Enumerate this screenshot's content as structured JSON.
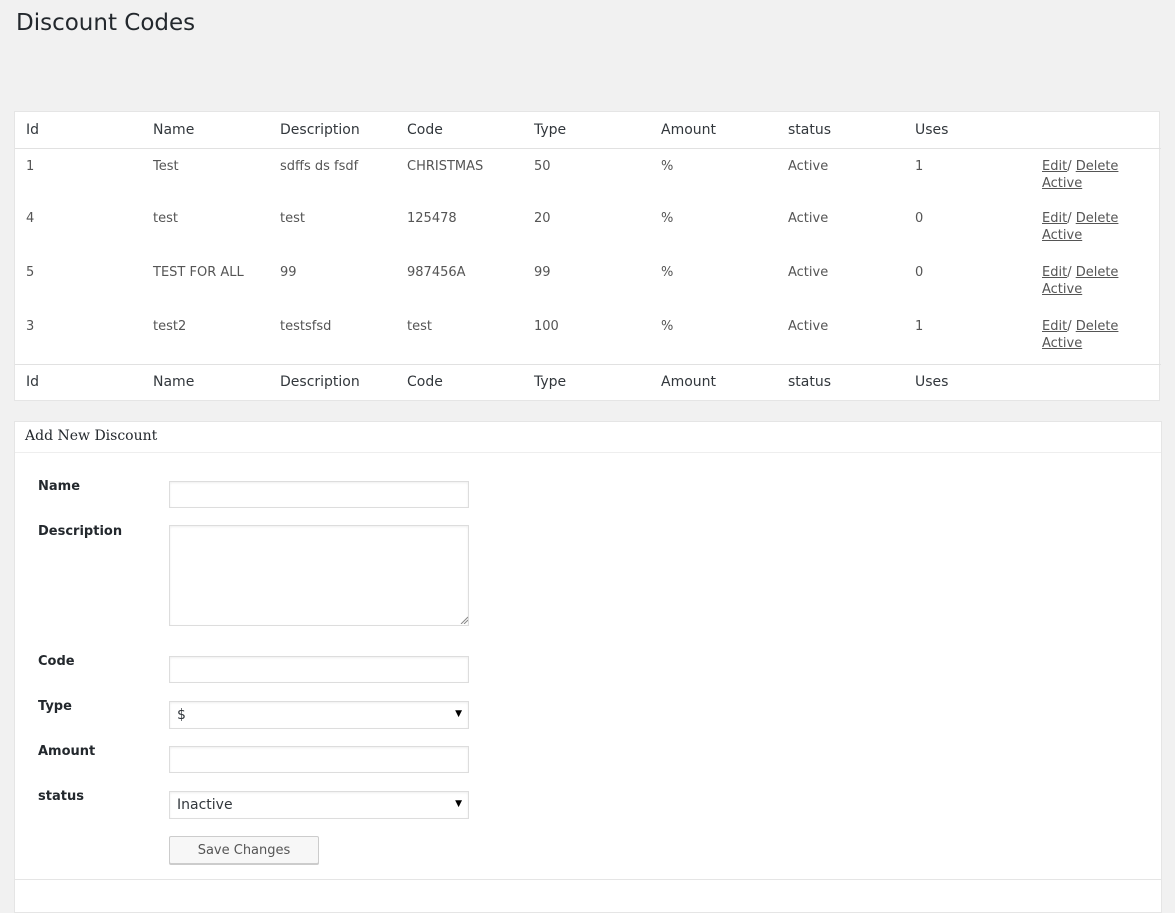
{
  "page": {
    "title": "Discount Codes"
  },
  "table": {
    "columns": [
      "Id",
      "Name",
      "Description",
      "Code",
      "Type",
      "Amount",
      "status",
      "Uses",
      ""
    ],
    "rows": [
      {
        "id": "1",
        "name": "Test",
        "description": "sdffs ds fsdf",
        "code": "CHRISTMAS",
        "type": "50",
        "amount": "%",
        "status": "Active",
        "uses": "1"
      },
      {
        "id": "4",
        "name": "test",
        "description": "test",
        "code": "125478",
        "type": "20",
        "amount": "%",
        "status": "Active",
        "uses": "0"
      },
      {
        "id": "5",
        "name": "TEST FOR ALL",
        "description": "99",
        "code": "987456A",
        "type": "99",
        "amount": "%",
        "status": "Active",
        "uses": "0"
      },
      {
        "id": "3",
        "name": "test2",
        "description": "testsfsd",
        "code": "test",
        "type": "100",
        "amount": "%",
        "status": "Active",
        "uses": "1"
      }
    ],
    "actions": {
      "edit": "Edit",
      "separator": "/ ",
      "delete": "Delete",
      "active": "Active"
    }
  },
  "form": {
    "title": "Add New Discount",
    "name_label": "Name",
    "name_value": "",
    "description_label": "Description",
    "description_value": "",
    "code_label": "Code",
    "code_value": "",
    "type_label": "Type",
    "type_selected": "$",
    "amount_label": "Amount",
    "amount_value": "",
    "status_label": "status",
    "status_selected": "Inactive",
    "save_label": "Save Changes"
  },
  "icons": {
    "dropdown": "chevron-down-icon",
    "resize": "resize-grip-icon"
  }
}
